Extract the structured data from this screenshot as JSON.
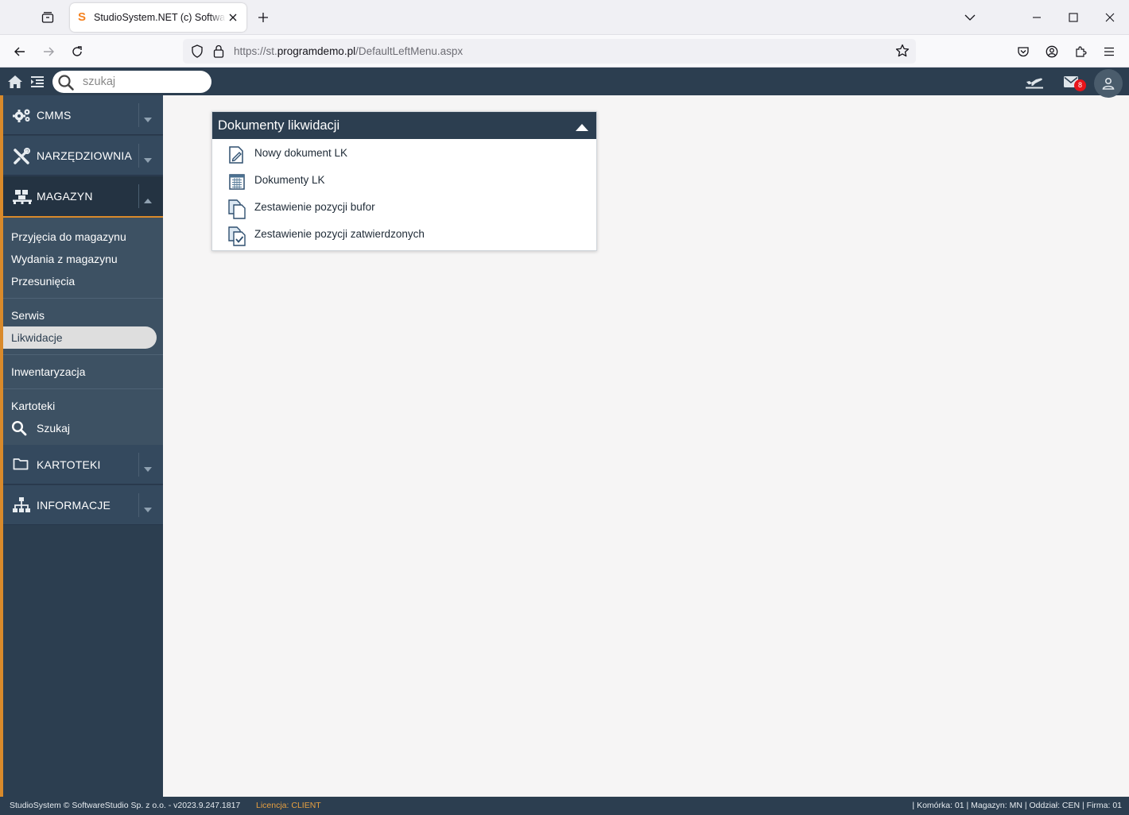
{
  "browser": {
    "tab_title": "StudioSystem.NET (c) SoftwareStudio",
    "favicon_letter": "S",
    "url_prefix": "https://st.",
    "url_host": "programdemo.pl",
    "url_path": "/DefaultLeftMenu.aspx"
  },
  "header": {
    "search_placeholder": "szukaj",
    "mail_badge": "8"
  },
  "sidebar": {
    "sections": [
      {
        "label": "CMMS",
        "icon": "gears-icon",
        "expanded": false
      },
      {
        "label": "NARZĘDZIOWNIA",
        "icon": "tools-icon",
        "expanded": false
      },
      {
        "label": "MAGAZYN",
        "icon": "pallet-icon",
        "expanded": true
      },
      {
        "label": "KARTOTEKI",
        "icon": "folder-icon",
        "expanded": false
      },
      {
        "label": "INFORMACJE",
        "icon": "sitemap-icon",
        "expanded": false
      }
    ],
    "magazyn_groups": [
      [
        "Przyjęcia do magazynu",
        "Wydania z magazynu",
        "Przesunięcia"
      ],
      [
        "Serwis",
        "Likwidacje"
      ],
      [
        "Inwentaryzacja"
      ],
      [
        "Kartoteki",
        "Szukaj"
      ]
    ],
    "selected_item": "Likwidacje"
  },
  "panel": {
    "title": "Dokumenty likwidacji",
    "items": [
      {
        "label": "Nowy dokument LK",
        "icon": "new-document-icon"
      },
      {
        "label": "Dokumenty LK",
        "icon": "document-list-icon"
      },
      {
        "label": "Zestawienie pozycji bufor",
        "icon": "copy-documents-icon"
      },
      {
        "label": "Zestawienie pozycji zatwierdzonych",
        "icon": "approved-documents-icon"
      }
    ]
  },
  "footer": {
    "copyright": "StudioSystem © SoftwareStudio Sp. z o.o. - v2023.9.247.1817",
    "license": "Licencja: CLIENT",
    "status": "| Komórka: 01 | Magazyn: MN | Oddział: CEN | Firma: 01"
  },
  "colors": {
    "navy": "#2c3e50",
    "accent_orange": "#d98a2b",
    "badge_red": "#e8141a"
  }
}
